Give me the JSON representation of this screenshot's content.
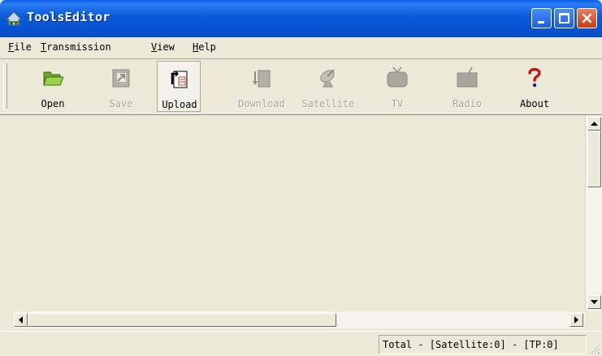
{
  "window": {
    "title": "ToolsEditor",
    "titlebar_color": "#0a5ad8"
  },
  "menu": [
    {
      "accel": "F",
      "rest": "ile"
    },
    {
      "accel": "T",
      "rest": "ransmission"
    },
    {
      "accel": "V",
      "rest": "iew"
    },
    {
      "accel": "H",
      "rest": "elp"
    }
  ],
  "toolbar": {
    "open": "Open",
    "save": "Save",
    "upload": "Upload",
    "download": "Download",
    "satellite": "Satellite",
    "tv": "TV",
    "radio": "Radio",
    "about": "About"
  },
  "status": {
    "text": "Total - [Satellite:0] - [TP:0]"
  },
  "icons": {
    "open": "folder-open-icon",
    "save": "save-icon",
    "upload": "upload-icon",
    "download": "download-icon",
    "satellite": "satellite-dish-icon",
    "tv": "tv-icon",
    "radio": "radio-icon",
    "about": "question-mark-icon"
  }
}
